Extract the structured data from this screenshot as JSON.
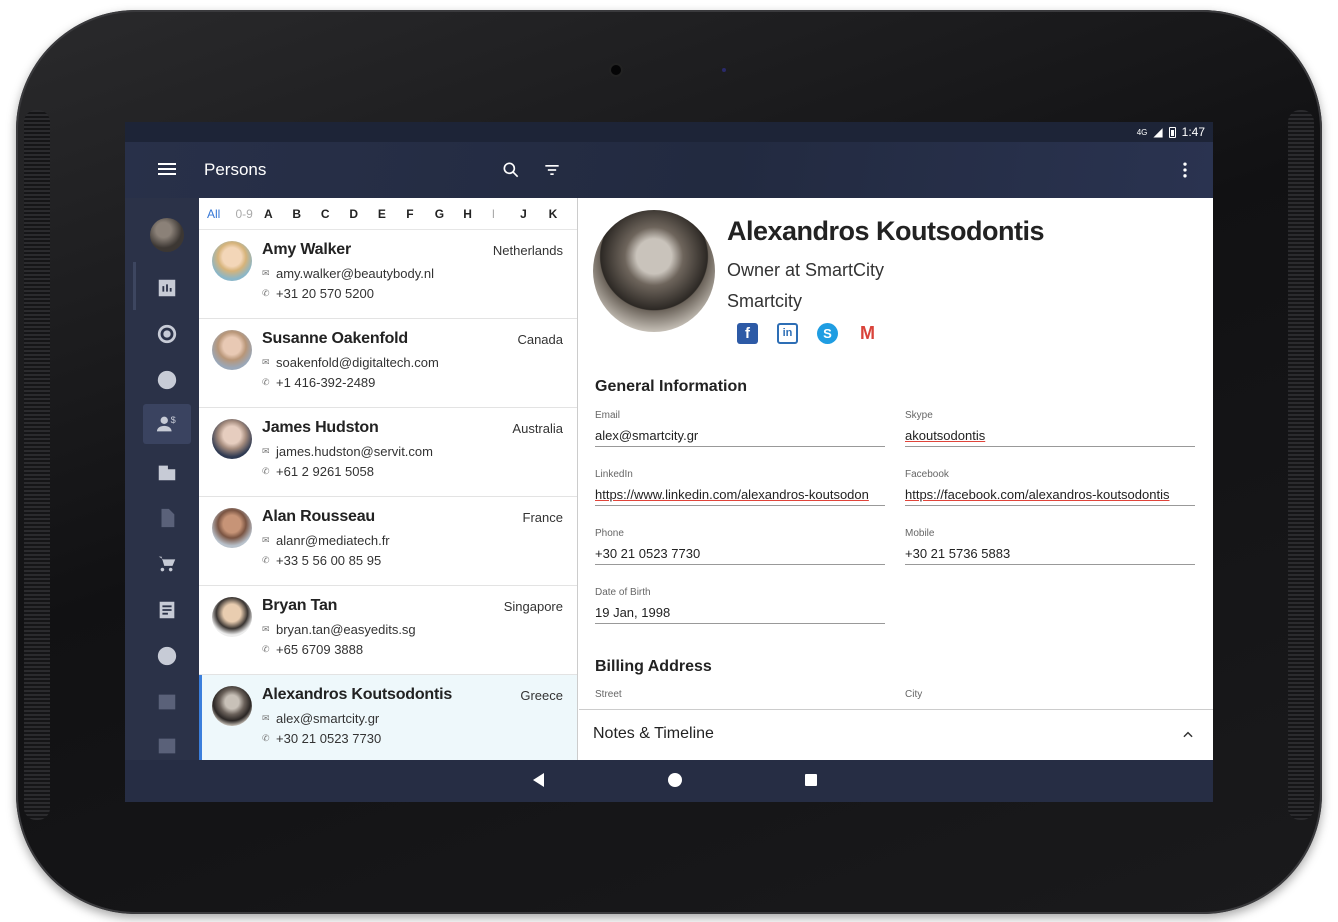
{
  "status": {
    "network": "4G",
    "time": "1:47"
  },
  "appbar": {
    "title": "Persons"
  },
  "alphabet": [
    "All",
    "0-9",
    "A",
    "B",
    "C",
    "D",
    "E",
    "F",
    "G",
    "H",
    "I",
    "J",
    "K"
  ],
  "contacts": [
    {
      "name": "Amy Walker",
      "country": "Netherlands",
      "email": "amy.walker@beautybody.nl",
      "phone": "+31 20 570 5200"
    },
    {
      "name": "Susanne Oakenfold",
      "country": "Canada",
      "email": "soakenfold@digitaltech.com",
      "phone": "+1 416-392-2489"
    },
    {
      "name": "James Hudston",
      "country": "Australia",
      "email": "james.hudston@servit.com",
      "phone": "+61 2 9261 5058"
    },
    {
      "name": "Alan Rousseau",
      "country": "France",
      "email": "alanr@mediatech.fr",
      "phone": "+33 5 56 00 85 95"
    },
    {
      "name": "Bryan Tan",
      "country": "Singapore",
      "email": "bryan.tan@easyedits.sg",
      "phone": "+65 6709 3888"
    },
    {
      "name": "Alexandros Koutsodontis",
      "country": "Greece",
      "email": "alex@smartcity.gr",
      "phone": "+30 21 0523 7730"
    }
  ],
  "detail": {
    "name": "Alexandros Koutsodontis",
    "role": "Owner at SmartCity",
    "company": "Smartcity",
    "general_title": "General Information",
    "fields": {
      "email": {
        "label": "Email",
        "value": "alex@smartcity.gr"
      },
      "skype": {
        "label": "Skype",
        "value": "akoutsodontis"
      },
      "linkedin": {
        "label": "LinkedIn",
        "value": "https://www.linkedin.com/alexandros-koutsodon"
      },
      "facebook": {
        "label": "Facebook",
        "value": "https://facebook.com/alexandros-koutsodontis"
      },
      "phone": {
        "label": "Phone",
        "value": "+30 21 0523 7730"
      },
      "mobile": {
        "label": "Mobile",
        "value": "+30 21 5736 5883"
      },
      "dob": {
        "label": "Date of Birth",
        "value": "19 Jan, 1998"
      }
    },
    "billing_title": "Billing Address",
    "street_label": "Street",
    "city_label": "City",
    "notes_title": "Notes & Timeline"
  },
  "colors": {
    "appbar": "#283049",
    "rail": "#2b3248",
    "accent": "#3b7fdc",
    "selected_bg": "#eef8fb"
  }
}
